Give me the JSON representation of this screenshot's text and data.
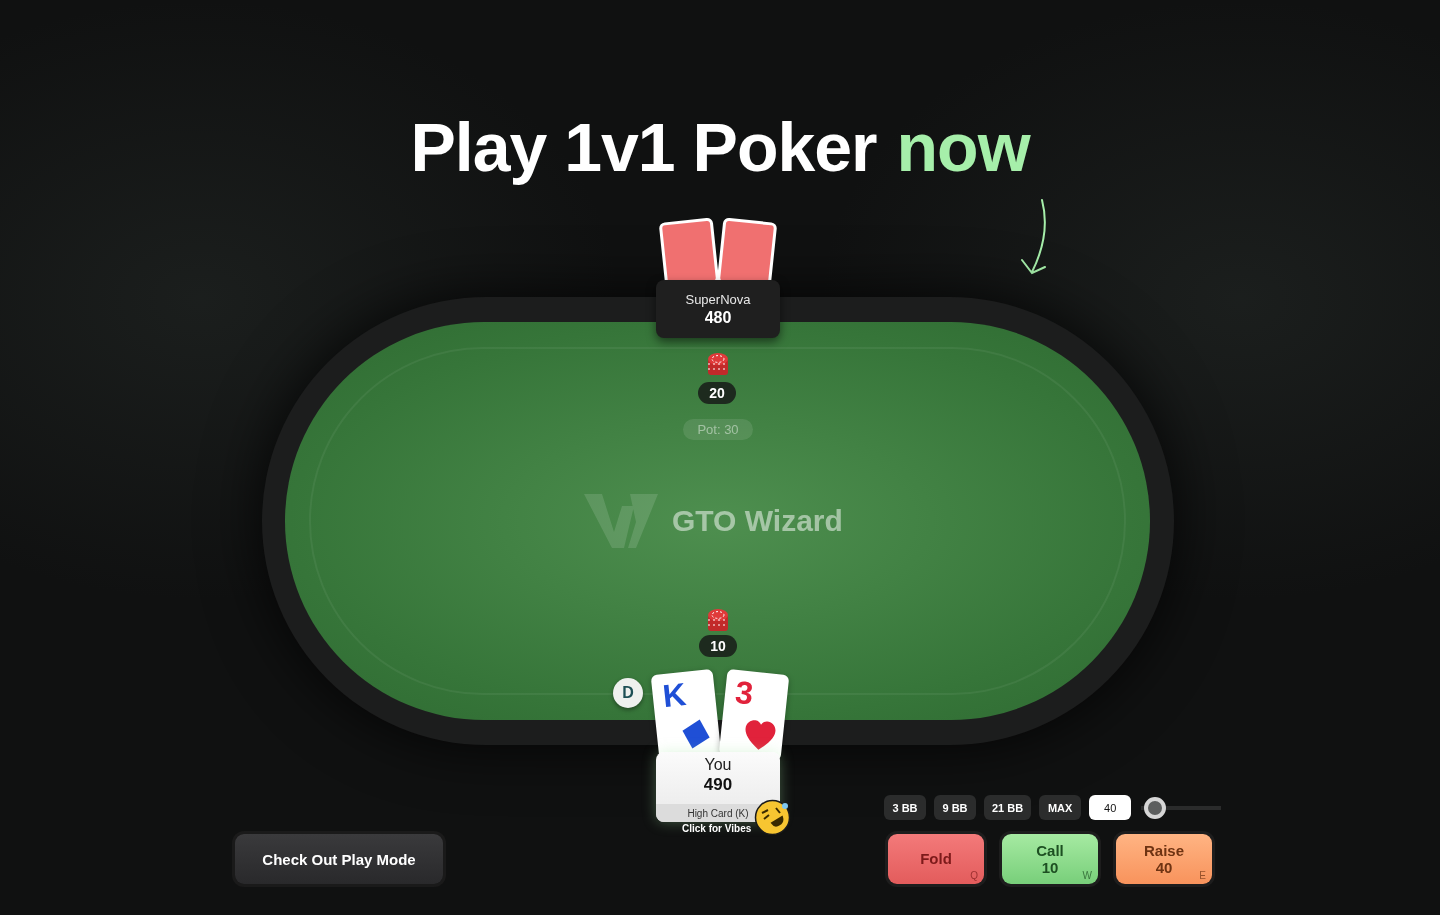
{
  "headline": {
    "text": "Play 1v1 Poker",
    "accent": "now"
  },
  "table": {
    "logo": "GTO Wizard",
    "pot": "Pot: 30"
  },
  "opponent": {
    "name": "SuperNova",
    "stack": "480",
    "bet": "20",
    "cards": [
      {
        "kind": "back"
      },
      {
        "kind": "back"
      }
    ]
  },
  "hero": {
    "name": "You",
    "stack": "490",
    "bet": "10",
    "dealer": "D",
    "hand": "High Card (K)",
    "vibes": "Click for Vibes",
    "cards": [
      {
        "kind": "diamond",
        "rank": "K"
      },
      {
        "kind": "heart",
        "rank": "3"
      }
    ]
  },
  "bet_sizes": [
    "3 BB",
    "9 BB",
    "21 BB",
    "MAX"
  ],
  "bet_input": {
    "value": "40"
  },
  "bet_slider": {
    "level": 0.05
  },
  "actions": [
    {
      "kind": "fold",
      "label": "Fold",
      "hotkey": "Q"
    },
    {
      "kind": "call",
      "label": "Call",
      "amount": "10",
      "hotkey": "W"
    },
    {
      "kind": "raise",
      "label": "Raise",
      "amount": "40",
      "hotkey": "E"
    }
  ],
  "play_mode_button": "Check Out Play Mode"
}
